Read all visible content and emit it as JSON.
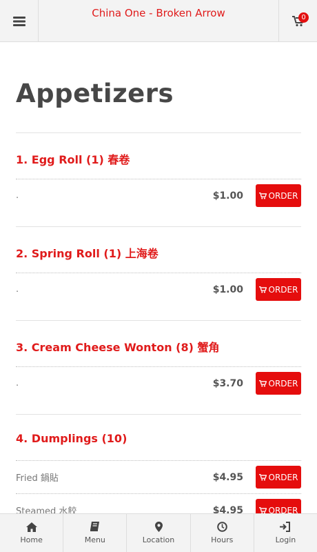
{
  "header": {
    "title": "China One - Broken Arrow",
    "menu_icon": "hamburger-icon",
    "cart_icon": "cart-icon",
    "cart_count": "0"
  },
  "page": {
    "title": "Appetizers"
  },
  "items": [
    {
      "name": "1. Egg Roll (1) 春卷",
      "rows": [
        {
          "label": ".",
          "price": "$1.00",
          "button": "ORDER"
        }
      ]
    },
    {
      "name": "2. Spring Roll (1) 上海卷",
      "rows": [
        {
          "label": ".",
          "price": "$1.00",
          "button": "ORDER"
        }
      ]
    },
    {
      "name": "3. Cream Cheese Wonton (8) 蟹角",
      "rows": [
        {
          "label": ".",
          "price": "$3.70",
          "button": "ORDER"
        }
      ]
    },
    {
      "name": "4. Dumplings (10)",
      "rows": [
        {
          "label": "Fried 鍋貼",
          "price": "$4.95",
          "button": "ORDER"
        },
        {
          "label": "Steamed 水餃",
          "price": "$4.95",
          "button": "ORDER"
        }
      ]
    }
  ],
  "nav": [
    {
      "label": "Home",
      "icon": "home-icon"
    },
    {
      "label": "Menu",
      "icon": "book-icon"
    },
    {
      "label": "Location",
      "icon": "map-pin-icon"
    },
    {
      "label": "Hours",
      "icon": "clock-icon"
    },
    {
      "label": "Login",
      "icon": "login-icon"
    }
  ],
  "colors": {
    "accent": "#e01b1b",
    "button": "#e50d0d",
    "bar": "#f3f3f3"
  }
}
